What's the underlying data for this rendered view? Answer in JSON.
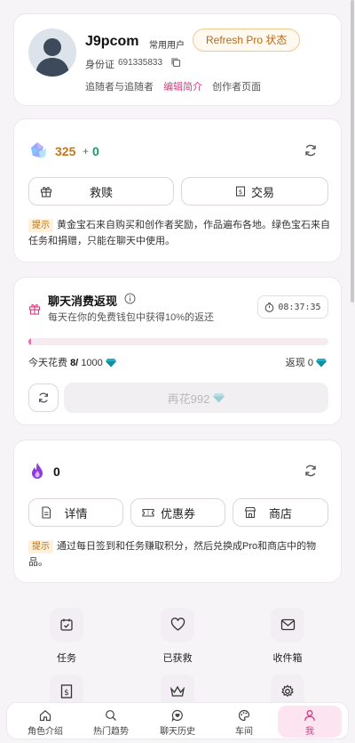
{
  "profile": {
    "username": "J9pcom",
    "user_tag": "常用用户",
    "pro_button": "Refresh Pro 状态",
    "id_label": "身份证",
    "id_value": "691335833",
    "links": [
      "追随者与追随者",
      "编辑简介",
      "创作者页面"
    ]
  },
  "gems": {
    "gold_count": "325",
    "plus": "+",
    "green_count": "0",
    "buttons": [
      "救赎",
      "交易"
    ],
    "hint_tag": "提示",
    "hint": "黄金宝石来自购买和创作者奖励，作品遍布各地。绿色宝石来自任务和捐赠，只能在聊天中使用。"
  },
  "cashback": {
    "title": "聊天消费返现",
    "subtitle": "每天在你的免费钱包中获得10%的返还",
    "timer": "08:37:35",
    "progress": 0.01,
    "spend_label": "今天花费",
    "spend_value": "8/",
    "spend_limit": "1000",
    "rebate_label": "返现",
    "rebate_value": "0",
    "spend_more": "再花992"
  },
  "points": {
    "count": "0",
    "buttons": [
      "详情",
      "优惠券",
      "商店"
    ],
    "hint_tag": "提示",
    "hint": "通过每日签到和任务赚取积分，然后兑换成Pro和商店中的物品。"
  },
  "grid": [
    "任务",
    "已获救",
    "收件箱"
  ],
  "nav": [
    "角色介绍",
    "热门趋势",
    "聊天历史",
    "车间",
    "我"
  ],
  "colors": {
    "accent": "#d63c84",
    "gold": "#c7761b",
    "green": "#1a9a6c",
    "diamond": "#1ab3c9"
  }
}
